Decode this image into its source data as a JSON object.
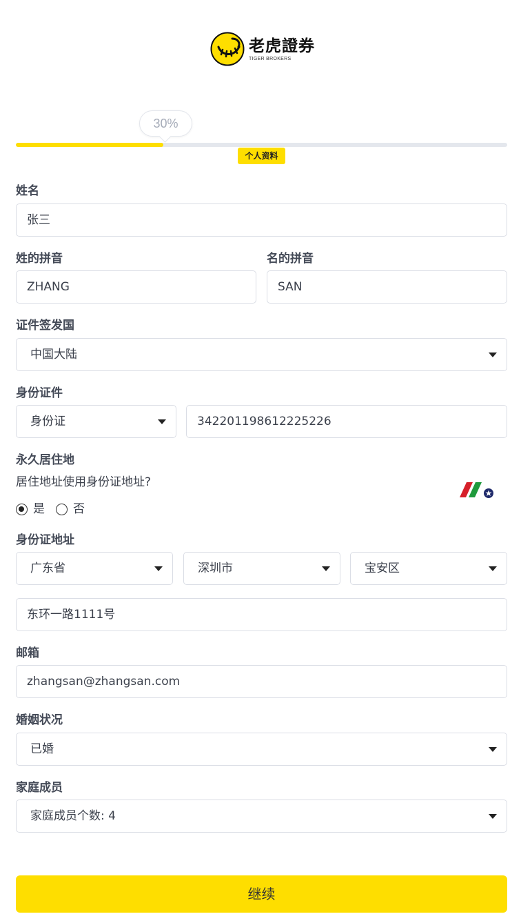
{
  "brand": {
    "name_cn": "老虎證券",
    "name_en": "TIGER BROKERS",
    "accent_color": "#fede00"
  },
  "progress": {
    "percent_label": "30%",
    "value": 0.3,
    "step_label": "个人资料"
  },
  "form": {
    "name": {
      "label": "姓名",
      "value": "张三"
    },
    "surname_pinyin": {
      "label": "姓的拼音",
      "value": "ZHANG"
    },
    "given_pinyin": {
      "label": "名的拼音",
      "value": "SAN"
    },
    "issuing_country": {
      "label": "证件签发国",
      "value": "中国大陆"
    },
    "id_document": {
      "label": "身份证件",
      "type": "身份证",
      "number": "342201198612225226"
    },
    "residence": {
      "label": "永久居住地",
      "question": "居住地址使用身份证地址?",
      "options": [
        {
          "label": "是",
          "selected": true
        },
        {
          "label": "否",
          "selected": false
        }
      ]
    },
    "id_address": {
      "label": "身份证地址",
      "province": "广东省",
      "city": "深圳市",
      "district": "宝安区",
      "street": "东环一路1111号"
    },
    "email": {
      "label": "邮箱",
      "value": "zhangsan@zhangsan.com"
    },
    "marital_status": {
      "label": "婚姻状况",
      "value": "已婚"
    },
    "family": {
      "label": "家庭成员",
      "value": "家庭成员个数: 4"
    }
  },
  "continue_label": "继续"
}
